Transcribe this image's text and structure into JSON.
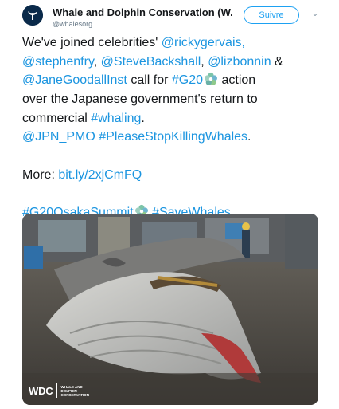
{
  "account": {
    "display_name": "Whale and Dolphin Conservation (W...",
    "handle": "@whalesorg",
    "follow_label": "Suivre"
  },
  "tweet": {
    "line1_text": "We've joined celebrities' ",
    "line1_link": "@rickygervais,",
    "line2_link1": "@stephenfry",
    "line2_sep1": ", ",
    "line2_link2": "@SteveBackshall",
    "line2_sep2": ", ",
    "line2_link3": "@lizbonnin",
    "line2_tail": " &",
    "line3_link1": "@JaneGoodallInst",
    "line3_text": " call for ",
    "line3_link2": "#G20",
    "line3_tail": " action",
    "line4_text": "over the Japanese government's return to",
    "line5_text": "commercial ",
    "line5_link": "#whaling",
    "line5_tail": ".",
    "line6_link1": "@JPN_PMO",
    "line6_sep": " ",
    "line6_link2": "#PleaseStopKillingWhales",
    "line6_tail": ".",
    "more_label": "More: ",
    "more_link": "bit.ly/2xjCmFQ",
    "hashtag1": "#G20OsakaSummit",
    "hashtag2": "#SaveWhales"
  },
  "media": {
    "logo_letters": "WDC",
    "logo_sub": [
      "WHALE AND",
      "DOLPHIN",
      "CONSERVATION"
    ]
  },
  "icons": {
    "avatar": "wdc-whale-tail-logo",
    "caret": "chevron-down-icon",
    "g20_emoji": "g20-flower-emoji"
  },
  "colors": {
    "link": "#1b95e0",
    "follow": "#1da1f2",
    "text": "#14171a",
    "muted": "#657786"
  }
}
